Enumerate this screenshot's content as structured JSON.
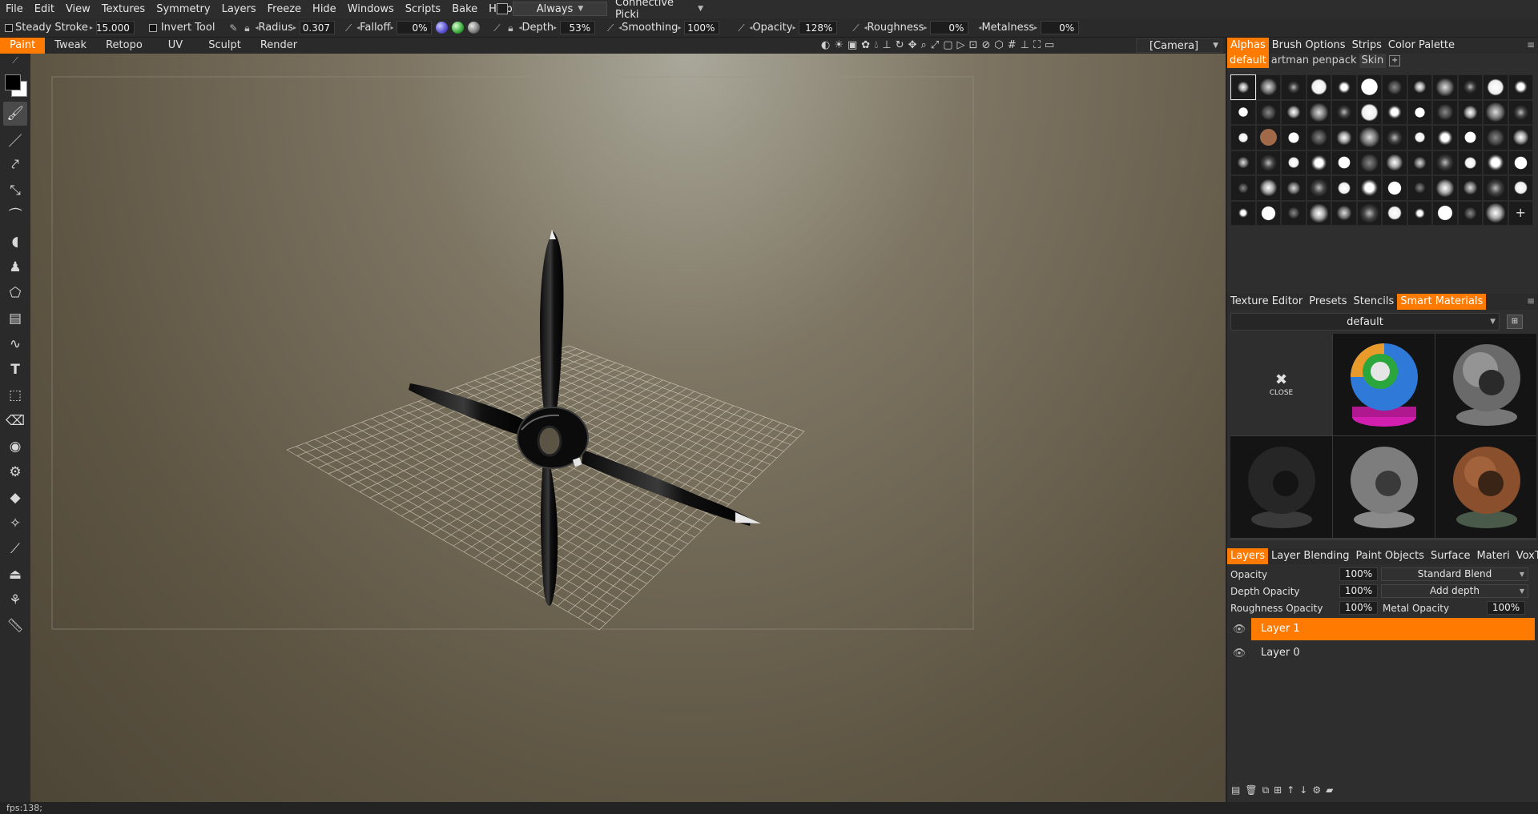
{
  "menubar": {
    "items": [
      "File",
      "Edit",
      "View",
      "Textures",
      "Symmetry",
      "Layers",
      "Freeze",
      "Hide",
      "Windows",
      "Scripts",
      "Bake",
      "Help"
    ],
    "always_label": "Always",
    "connective_label": "Connective  Picki"
  },
  "toolbar": {
    "steady_stroke_label": "Steady  Stroke",
    "steady_stroke_value": "15.000",
    "invert_tool_label": "Invert  Tool",
    "radius_label": "Radius",
    "radius_value": "0.307",
    "falloff_label": "Falloff",
    "falloff_value": "0%",
    "depth_label": "Depth",
    "depth_value": "53%",
    "smoothing_label": "Smoothing",
    "smoothing_value": "100%",
    "opacity_label": "Opacity",
    "opacity_value": "128%",
    "roughness_label": "Roughness",
    "roughness_value": "0%",
    "metalness_label": "Metalness",
    "metalness_value": "0%"
  },
  "rooms": {
    "tabs": [
      "Paint",
      "Tweak",
      "Retopo",
      "UV",
      "Sculpt",
      "Render"
    ],
    "active": "Paint",
    "camera_label": "[Camera]"
  },
  "tools": [
    "brush-tool",
    "line-tool",
    "spline-tool",
    "fill-tool",
    "smudge-tool",
    "airbrush-tool",
    "clone-stamp-tool",
    "lasso-tool",
    "document-tool",
    "curve-tool",
    "text-tool",
    "transform-tool",
    "eraser-tool",
    "eye-tool",
    "gear-tool",
    "ruler-tool",
    "wand-tool",
    "pen-tool",
    "iron-tool",
    "symmetry-tool",
    "measure-tool"
  ],
  "alphas_panel": {
    "tabs": [
      "Alphas",
      "Brush  Options",
      "Strips",
      "Color  Palette"
    ],
    "active": "Alphas",
    "subtabs": [
      "default",
      "artman  penpack",
      "Skin"
    ],
    "active_subtab": "default",
    "new_label": "NEW"
  },
  "smart_materials_panel": {
    "tabs": [
      "Texture  Editor",
      "Presets",
      "Stencils",
      "Smart  Materials"
    ],
    "active": "Smart  Materials",
    "preset_name": "default",
    "close_label": "CLOSE"
  },
  "layers_panel": {
    "tabs": [
      "Layers",
      "Layer  Blending",
      "Paint  Objects",
      "Surface",
      "Materi",
      "VoxTree"
    ],
    "active": "Layers",
    "opacity_label": "Opacity",
    "opacity_value": "100%",
    "blend_mode": "Standard  Blend",
    "depth_opacity_label": "Depth  Opacity",
    "depth_opacity_value": "100%",
    "depth_mode": "Add  depth",
    "roughness_opacity_label": "Roughness  Opacity",
    "roughness_opacity_value": "100%",
    "metal_opacity_label": "Metal  Opacity",
    "metal_opacity_value": "100%",
    "layers": [
      {
        "name": "Layer  1",
        "active": true
      },
      {
        "name": "Layer  0",
        "active": false
      }
    ]
  },
  "status": {
    "fps": "fps:138;"
  },
  "colors": {
    "accent": "#ff7a00",
    "panel_bg": "#2e2e2e",
    "viewport_top": "#aaa89a",
    "viewport_bottom": "#4d4536"
  }
}
